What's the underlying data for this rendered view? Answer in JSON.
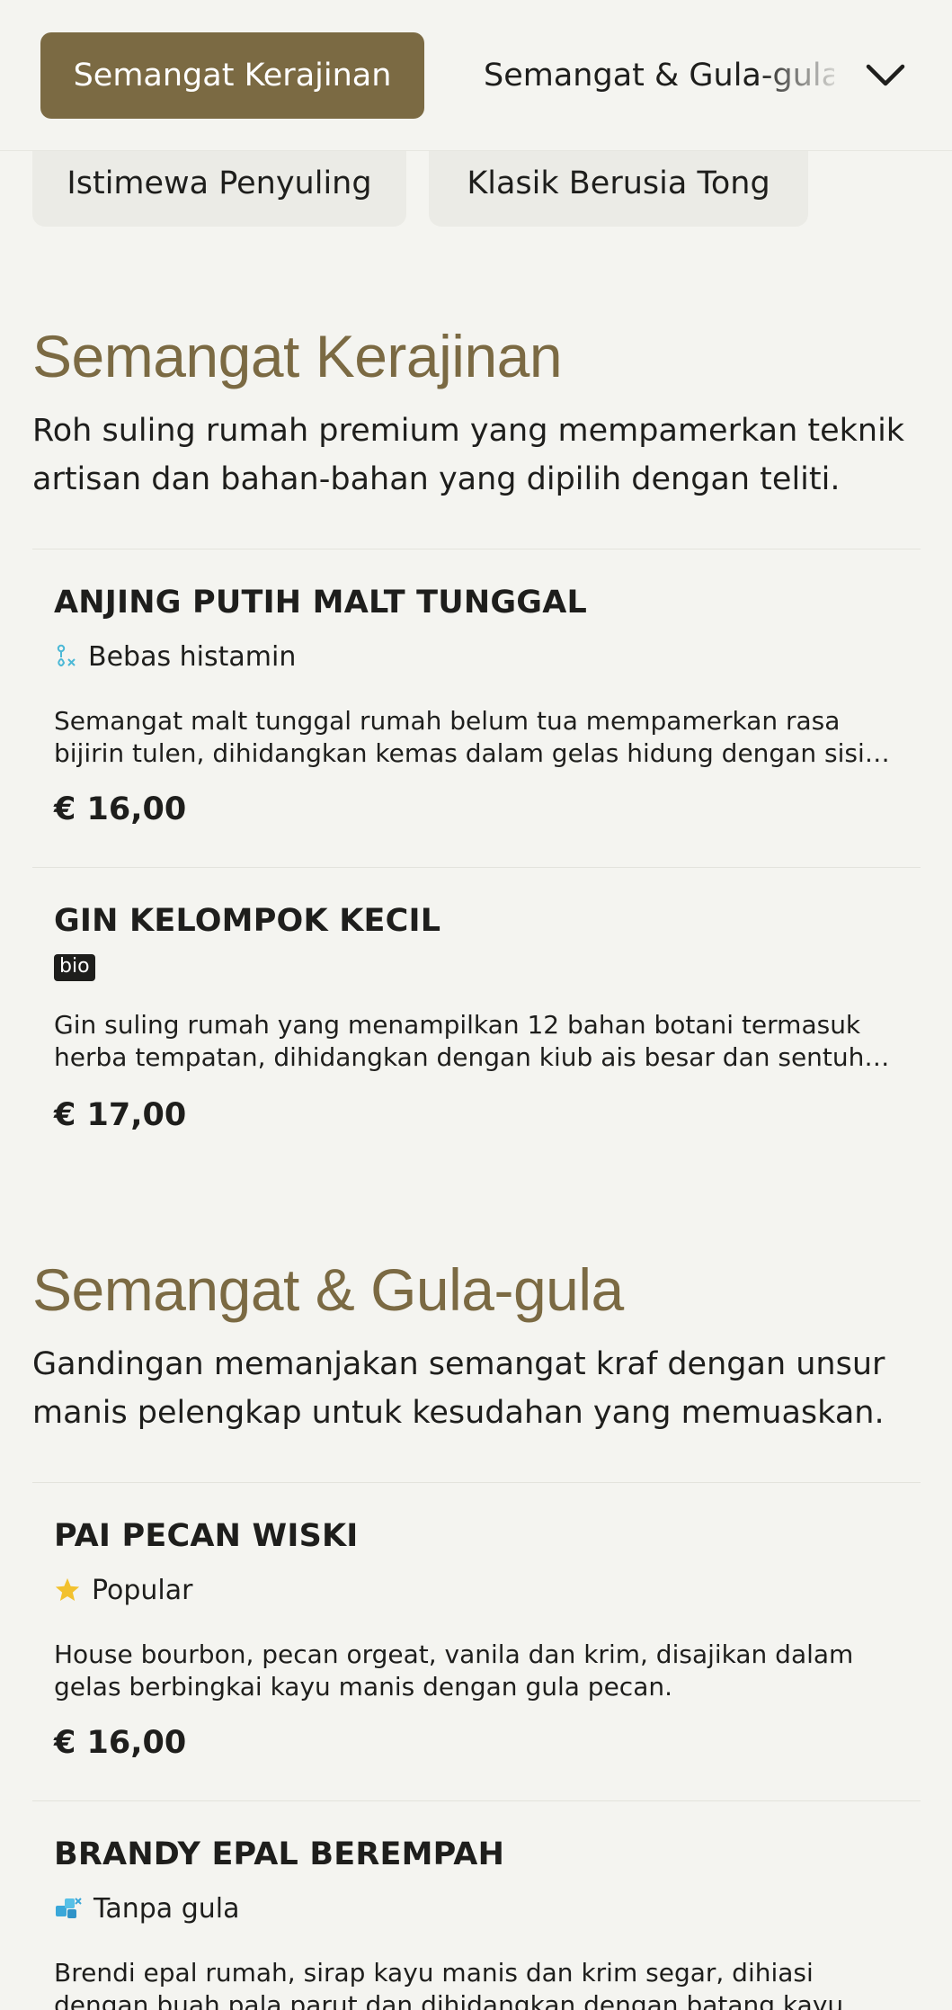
{
  "nav": {
    "active_category": "Semangat Kerajinan",
    "next_category": "Semangat & Gula-gula",
    "subcategories": [
      "Istimewa Penyuling",
      "Klasik Berusia Tong"
    ]
  },
  "colors": {
    "accent": "#7b6a43",
    "background": "#f4f4f0",
    "pill_background": "#ebebe6",
    "text": "#1e1e1c"
  },
  "sections": [
    {
      "title": "Semangat Kerajinan",
      "description": "Roh suling rumah premium yang mempamerkan teknik artisan dan bahan-bahan yang dipilih dengan teliti.",
      "items": [
        {
          "name": "ANJING PUTIH MALT TUNGGAL",
          "tag": {
            "icon": "histamine-free-icon",
            "label": "Bebas histamin"
          },
          "description": "Semangat malt tunggal rumah belum tua mempamerkan rasa bijirin tulen, dihidangkan kemas dalam gelas hidung dengan sisi tepi air sejuk.",
          "price": "€ 16,00"
        },
        {
          "name": "GIN KELOMPOK KECIL",
          "tag": {
            "icon": "bio-badge",
            "label": "bio"
          },
          "description": "Gin suling rumah yang menampilkan 12 bahan botani termasuk herba tempatan, dihidangkan dengan kiub ais besar dan sentuhan kulit limau.",
          "price": "€ 17,00"
        }
      ]
    },
    {
      "title": "Semangat & Gula-gula",
      "description": "Gandingan memanjakan semangat kraf dengan unsur manis pelengkap untuk kesudahan yang memuaskan.",
      "items": [
        {
          "name": "PAI PECAN WISKI",
          "tag": {
            "icon": "star-icon",
            "label": "Popular"
          },
          "description": "House bourbon, pecan orgeat, vanila dan krim, disajikan dalam gelas berbingkai kayu manis dengan gula pecan.",
          "price": "€ 16,00"
        },
        {
          "name": "BRANDY EPAL BEREMPAH",
          "tag": {
            "icon": "sugar-free-icon",
            "label": "Tanpa gula"
          },
          "description": "Brendi epal rumah, sirap kayu manis dan krim segar, dihiasi dengan buah pala parut dan dihidangkan dengan batang kayu manis."
        }
      ]
    }
  ]
}
